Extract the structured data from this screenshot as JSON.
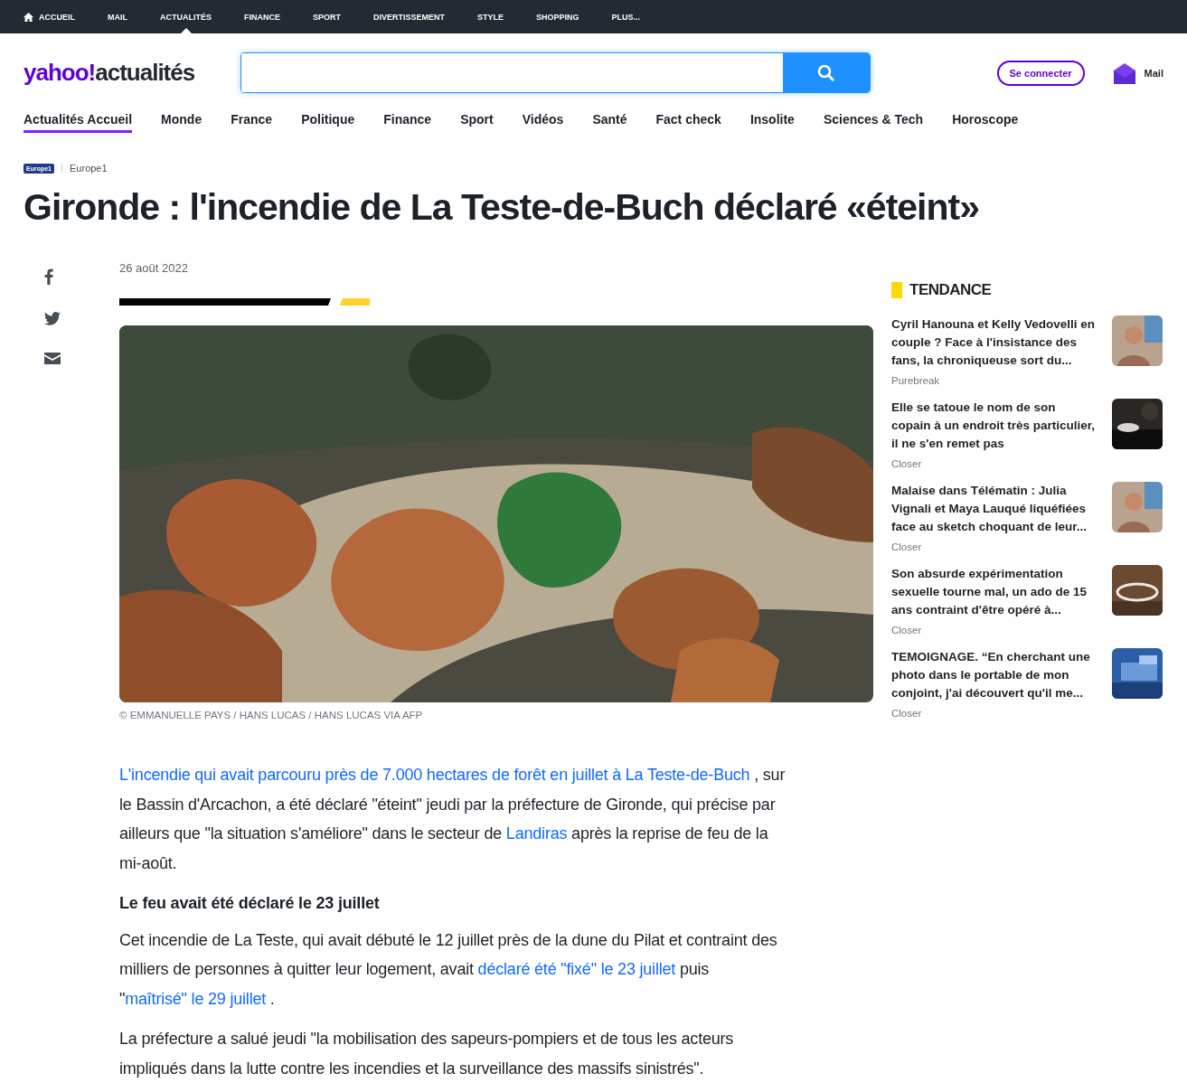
{
  "top_nav": [
    {
      "label": "ACCUEIL",
      "kind": "home",
      "selected": false
    },
    {
      "label": "MAIL",
      "kind": "plain",
      "selected": false
    },
    {
      "label": "ACTUALITÉS",
      "kind": "plain",
      "selected": true
    },
    {
      "label": "FINANCE",
      "kind": "plain",
      "selected": false
    },
    {
      "label": "SPORT",
      "kind": "plain",
      "selected": false
    },
    {
      "label": "DIVERTISSEMENT",
      "kind": "plain",
      "selected": false
    },
    {
      "label": "STYLE",
      "kind": "plain",
      "selected": false
    },
    {
      "label": "SHOPPING",
      "kind": "plain",
      "selected": false
    },
    {
      "label": "PLUS...",
      "kind": "plain",
      "selected": false
    }
  ],
  "header": {
    "logo_brand": "yahoo!",
    "logo_section": "actualités",
    "sign_in": "Se connecter",
    "mail": "Mail"
  },
  "section_nav": [
    {
      "label": "Actualités Accueil",
      "selected": true
    },
    {
      "label": "Monde",
      "selected": false
    },
    {
      "label": "France",
      "selected": false
    },
    {
      "label": "Politique",
      "selected": false
    },
    {
      "label": "Finance",
      "selected": false
    },
    {
      "label": "Sport",
      "selected": false
    },
    {
      "label": "Vidéos",
      "selected": false
    },
    {
      "label": "Santé",
      "selected": false
    },
    {
      "label": "Fact check",
      "selected": false
    },
    {
      "label": "Insolite",
      "selected": false
    },
    {
      "label": "Sciences & Tech",
      "selected": false
    },
    {
      "label": "Horoscope",
      "selected": false
    }
  ],
  "article": {
    "source_logo": "Europe1",
    "source": "Europe1",
    "title": "Gironde : l'incendie de La Teste-de-Buch déclaré «éteint»",
    "date": "26 août 2022",
    "photo": {
      "credit": "© EMMANUELLE PAYS / HANS LUCAS / HANS LUCAS VIA AFP"
    },
    "body": [
      {
        "kind": "paragraph",
        "segments": [
          {
            "text": "L'incendie qui avait parcouru près de 7.000 hectares de forêt en juillet à La Teste-de-Buch",
            "kind": "link"
          },
          {
            "text": " , sur le Bassin d'Arcachon, a été déclaré \"éteint\" jeudi par la préfecture de Gironde, qui précise par ailleurs que \"la situation s'améliore\" dans le secteur de ",
            "kind": "text"
          },
          {
            "text": "Landiras",
            "kind": "link"
          },
          {
            "text": " après la reprise de feu de la mi-août.",
            "kind": "text"
          }
        ]
      },
      {
        "kind": "heading",
        "segments": [
          {
            "text": "Le feu avait été déclaré le 23 juillet",
            "kind": "text"
          }
        ]
      },
      {
        "kind": "paragraph",
        "segments": [
          {
            "text": "Cet incendie de La Teste, qui avait débuté le 12 juillet près de la dune du Pilat et contraint des milliers de personnes à quitter leur logement, avait ",
            "kind": "text"
          },
          {
            "text": "déclaré été \"fixé\" le 23 juillet",
            "kind": "link"
          },
          {
            "text": " puis \"",
            "kind": "text"
          },
          {
            "text": "maîtrisé\" le 29 juillet",
            "kind": "link"
          },
          {
            "text": " .",
            "kind": "text"
          }
        ]
      },
      {
        "kind": "paragraph",
        "segments": [
          {
            "text": "La préfecture a salué jeudi \"la mobilisation des sapeurs-pompiers et de tous les acteurs impliqués dans la lutte contre les incendies et la surveillance des massifs sinistrés\".",
            "kind": "text"
          }
        ]
      }
    ]
  },
  "share": [
    {
      "kind": "facebook"
    },
    {
      "kind": "twitter"
    },
    {
      "kind": "email"
    }
  ],
  "trending": {
    "title": "TENDANCE",
    "items": [
      {
        "headline": "Cyril Hanouna et Kelly Vedovelli en couple ? Face à l'insistance des fans, la chroniqueuse sort du...",
        "source": "Purebreak"
      },
      {
        "headline": "Elle se tatoue le nom de son copain à un endroit très particulier, il ne s'en remet pas",
        "source": "Closer",
        "kind": "dark"
      },
      {
        "headline": "Malaise dans Télématin : Julia Vignali et Maya Lauqué liquéfiées face au sketch choquant de leur...",
        "source": "Closer"
      },
      {
        "headline": "Son absurde expérimentation sexuelle tourne mal, un ado de 15 ans contraint d'être opéré à...",
        "source": "Closer"
      },
      {
        "headline": "TEMOIGNAGE. “En cherchant une photo dans le portable de mon conjoint, j'ai découvert qu'il me...",
        "source": "Closer",
        "kind": "blue"
      }
    ]
  }
}
